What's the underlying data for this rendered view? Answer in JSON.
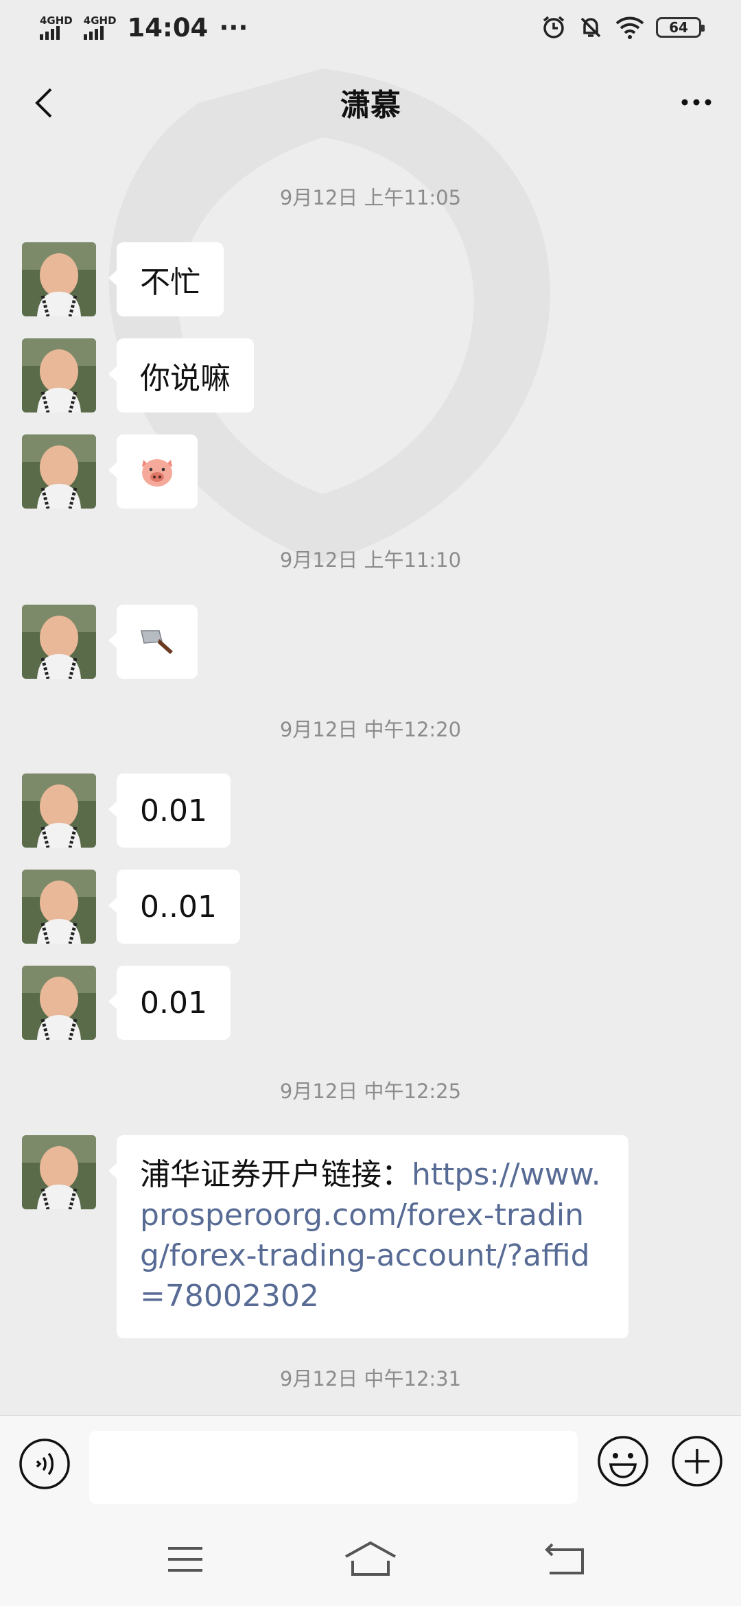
{
  "status_bar": {
    "net1": "4G",
    "net1_sup": "HD",
    "net2": "4G",
    "net2_sup": "HD",
    "time": "14:04",
    "more": "···",
    "battery": "64"
  },
  "header": {
    "title": "潇慕"
  },
  "chat": {
    "timestamps": [
      "9月12日 上午11:05",
      "9月12日 上午11:10",
      "9月12日 中午12:20",
      "9月12日 中午12:25",
      "9月12日 中午12:31"
    ],
    "messages": [
      {
        "type": "text",
        "text": "不忙"
      },
      {
        "type": "text",
        "text": "你说嘛"
      },
      {
        "type": "emoji",
        "emoji": "pig-face-emoji"
      },
      {
        "type": "emoji",
        "emoji": "kitchen-knife-emoji"
      },
      {
        "type": "text",
        "text": "0.01"
      },
      {
        "type": "text",
        "text": "0..01"
      },
      {
        "type": "text",
        "text": "0.01"
      },
      {
        "type": "link",
        "prefix": "浦华证券开户链接：",
        "link": "https://www.prosperoorg.com/forex-trading/forex-trading-account/?affid=78002302"
      }
    ]
  },
  "input": {
    "placeholder": ""
  },
  "colors": {
    "background": "#ededed",
    "bubble": "#ffffff",
    "link": "#576b95",
    "timestamp": "#8c8c8c"
  }
}
